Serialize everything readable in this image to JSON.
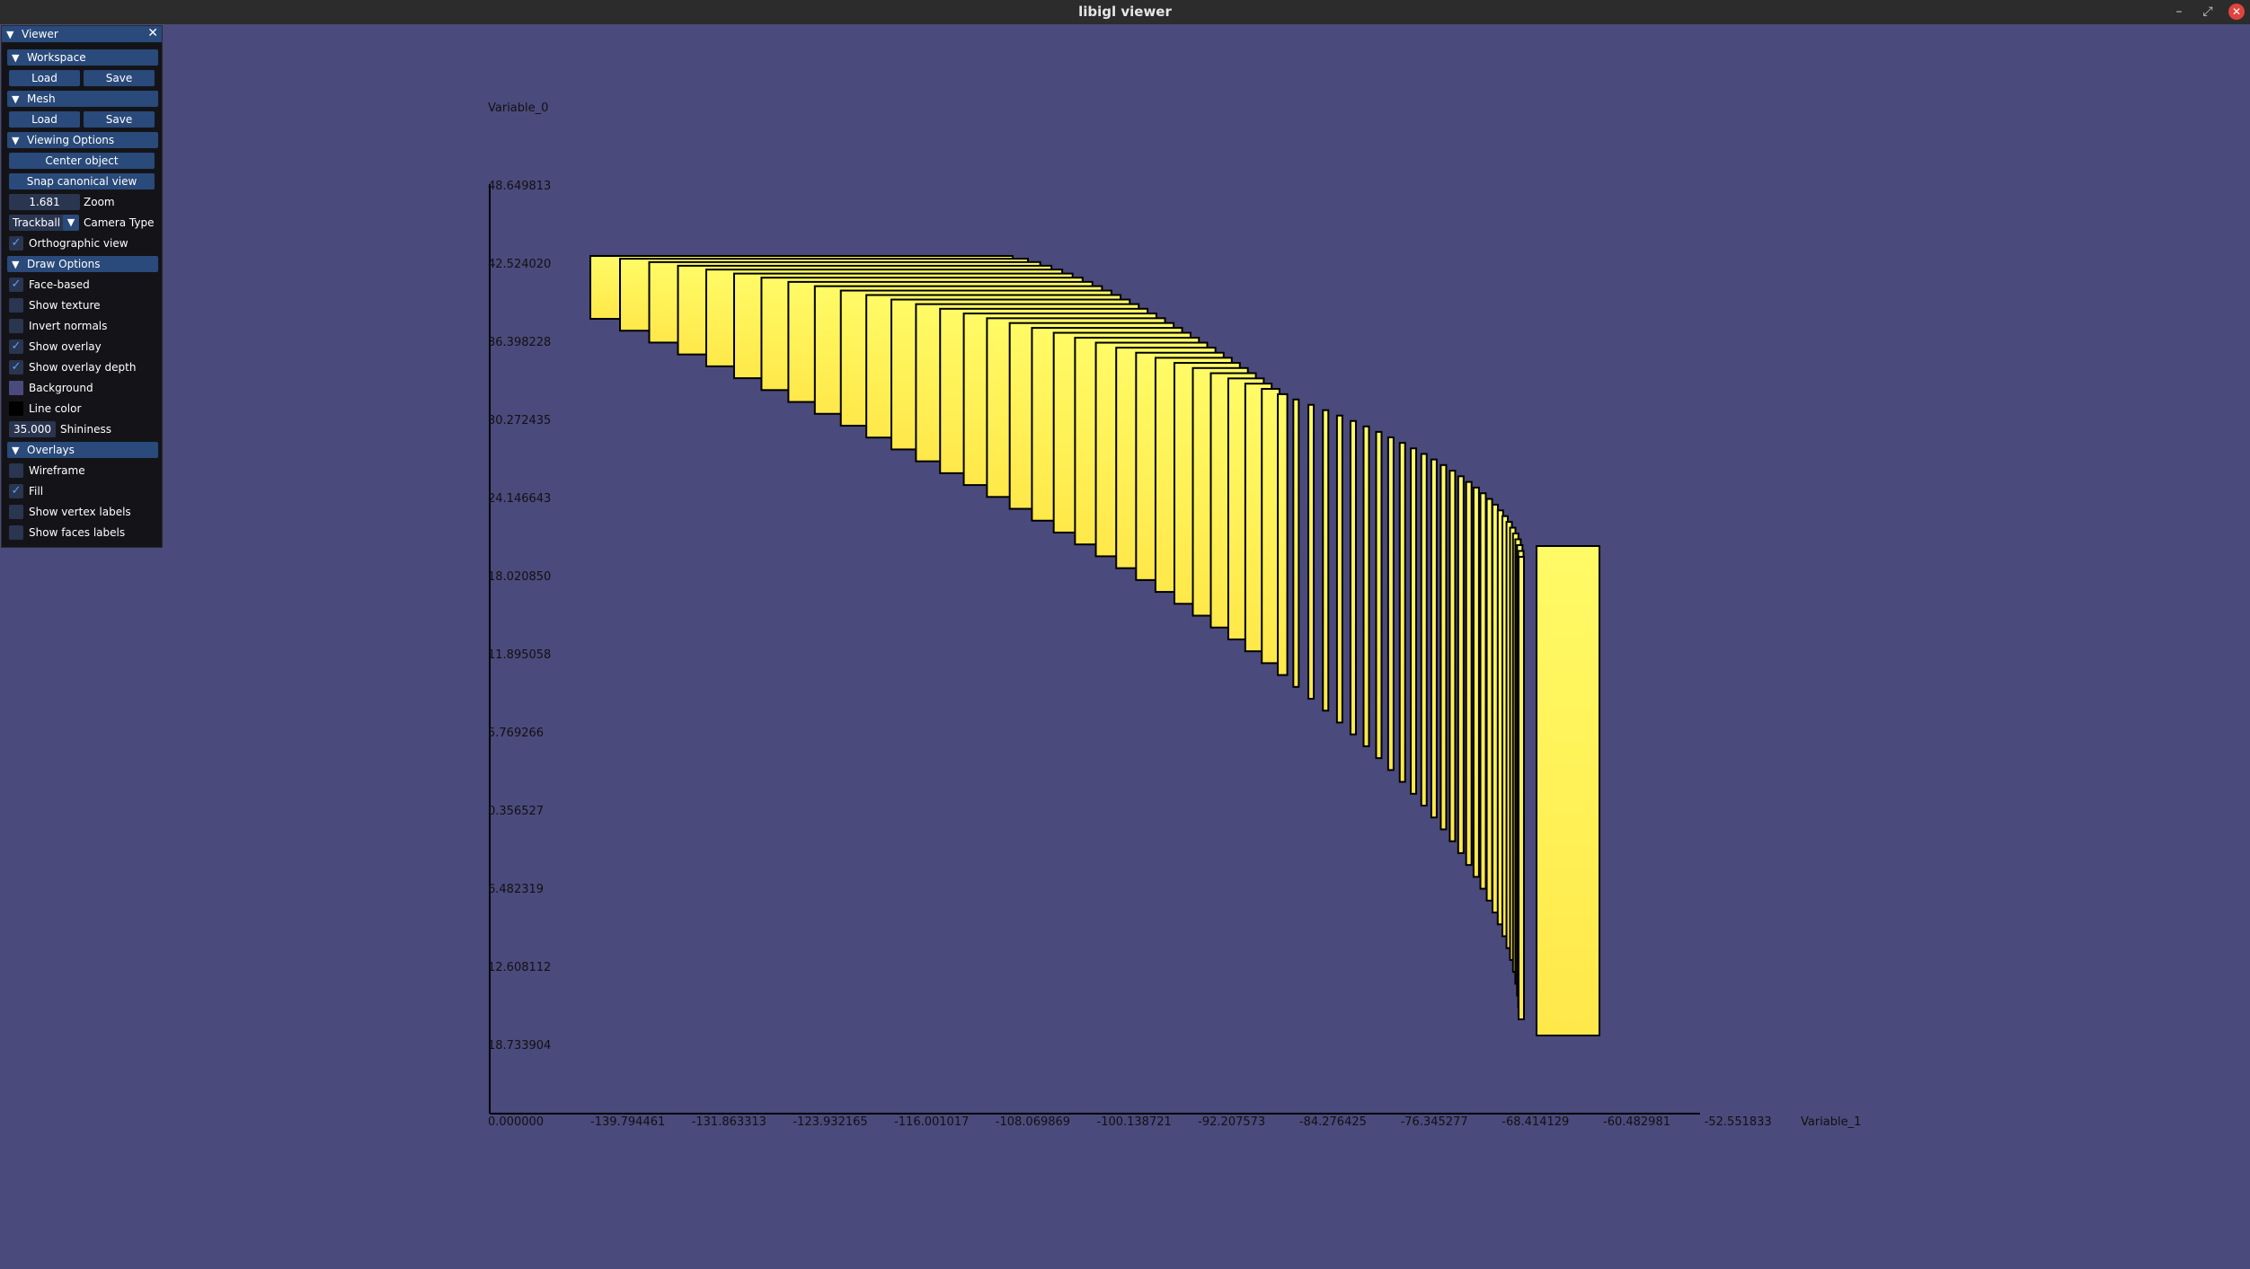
{
  "window": {
    "title": "libigl viewer"
  },
  "panel": {
    "title": "Viewer",
    "workspace": {
      "header": "Workspace",
      "load": "Load",
      "save": "Save"
    },
    "mesh": {
      "header": "Mesh",
      "load": "Load",
      "save": "Save"
    },
    "viewing": {
      "header": "Viewing Options",
      "center": "Center object",
      "snap": "Snap canonical view",
      "zoom_value": "1.681",
      "zoom_label": "Zoom",
      "camera_value": "Trackball",
      "camera_label": "Camera Type",
      "ortho_label": "Orthographic view",
      "ortho_checked": true
    },
    "draw": {
      "header": "Draw Options",
      "face_based": "Face-based",
      "face_based_checked": true,
      "show_texture": "Show texture",
      "show_texture_checked": false,
      "invert_normals": "Invert normals",
      "invert_normals_checked": false,
      "show_overlay": "Show overlay",
      "show_overlay_checked": true,
      "show_overlay_depth": "Show overlay depth",
      "show_overlay_depth_checked": true,
      "background": "Background",
      "background_color": "#4b4a7c",
      "line_color": "Line color",
      "line_color_value": "#000000",
      "shininess_value": "35.000",
      "shininess_label": "Shininess"
    },
    "overlays": {
      "header": "Overlays",
      "wireframe": "Wireframe",
      "wireframe_checked": false,
      "fill": "Fill",
      "fill_checked": true,
      "vertex_labels": "Show vertex labels",
      "vertex_labels_checked": false,
      "faces_labels": "Show faces labels",
      "faces_labels_checked": false
    }
  },
  "chart_data": {
    "type": "bar",
    "xlabel": "Variable_1",
    "ylabel": "Variable_0",
    "yticks": [
      "48.649813",
      "42.524020",
      "36.398228",
      "30.272435",
      "24.146643",
      "18.020850",
      "11.895058",
      "5.769266",
      "0.356527",
      "6.482319",
      "12.608112",
      "18.733904"
    ],
    "xticks": [
      "-139.794461",
      "-131.863313",
      "-123.932165",
      "-116.001017",
      "-108.069869",
      "-100.138721",
      "-92.207573",
      "-84.276425",
      "-76.345277",
      "-68.414129",
      "-60.482981",
      "-52.551833"
    ],
    "origin_label": "0.000000",
    "bar_color": "#fff95a",
    "outline_color": "#000000"
  }
}
